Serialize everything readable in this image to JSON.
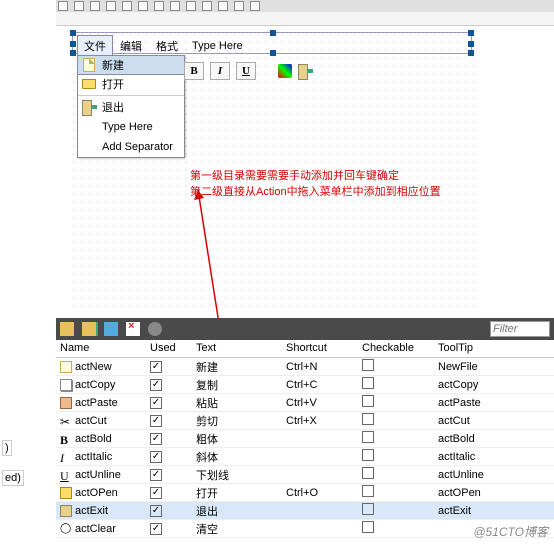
{
  "menubar": {
    "items": [
      "文件",
      "编辑",
      "格式",
      "Type Here"
    ]
  },
  "dropdown": {
    "items": [
      {
        "label": "新建",
        "icon": "new-file-icon"
      },
      {
        "label": "打开",
        "icon": "open-folder-icon"
      },
      {
        "label": "退出",
        "icon": "exit-icon"
      },
      {
        "label": "Type Here",
        "icon": ""
      },
      {
        "label": "Add Separator",
        "icon": ""
      }
    ]
  },
  "toolbar2": {
    "bold": "B",
    "italic": "I",
    "underline": "U"
  },
  "annotation": {
    "line1": "第一级目录需要需要手动添加并回车键确定",
    "line2": "第二级直接从Action中拖入菜单栏中添加到相应位置"
  },
  "left_labels": {
    "a": ")",
    "b": "ed)"
  },
  "filter": {
    "placeholder": "Filter"
  },
  "table": {
    "headers": {
      "name": "Name",
      "used": "Used",
      "text": "Text",
      "shortcut": "Shortcut",
      "checkable": "Checkable",
      "tooltip": "ToolTip"
    },
    "rows": [
      {
        "name": "actNew",
        "used": true,
        "text": "新建",
        "shortcut": "Ctrl+N",
        "checkable": false,
        "tooltip": "NewFile",
        "icon": "r-new"
      },
      {
        "name": "actCopy",
        "used": true,
        "text": "复制",
        "shortcut": "Ctrl+C",
        "checkable": false,
        "tooltip": "actCopy",
        "icon": "r-copy"
      },
      {
        "name": "actPaste",
        "used": true,
        "text": "粘贴",
        "shortcut": "Ctrl+V",
        "checkable": false,
        "tooltip": "actPaste",
        "icon": "r-paste"
      },
      {
        "name": "actCut",
        "used": true,
        "text": "剪切",
        "shortcut": "Ctrl+X",
        "checkable": false,
        "tooltip": "actCut",
        "icon": "r-cut",
        "glyph": "✂"
      },
      {
        "name": "actBold",
        "used": true,
        "text": "粗体",
        "shortcut": "",
        "checkable": false,
        "tooltip": "actBold",
        "icon": "r-b",
        "glyph": "B"
      },
      {
        "name": "actItalic",
        "used": true,
        "text": "斜体",
        "shortcut": "",
        "checkable": false,
        "tooltip": "actItalic",
        "icon": "r-i",
        "glyph": "I"
      },
      {
        "name": "actUnline",
        "used": true,
        "text": "下划线",
        "shortcut": "",
        "checkable": false,
        "tooltip": "actUnline",
        "icon": "r-u",
        "glyph": "U"
      },
      {
        "name": "actOPen",
        "used": true,
        "text": "打开",
        "shortcut": "Ctrl+O",
        "checkable": false,
        "tooltip": "actOPen",
        "icon": "r-open"
      },
      {
        "name": "actExit",
        "used": true,
        "text": "退出",
        "shortcut": "",
        "checkable": false,
        "tooltip": "actExit",
        "icon": "r-exit",
        "sel": true
      },
      {
        "name": "actClear",
        "used": true,
        "text": "清空",
        "shortcut": "",
        "checkable": false,
        "tooltip": "",
        "icon": "r-clear",
        "glyph": "◯"
      }
    ]
  },
  "watermark": "@51CTO博客"
}
